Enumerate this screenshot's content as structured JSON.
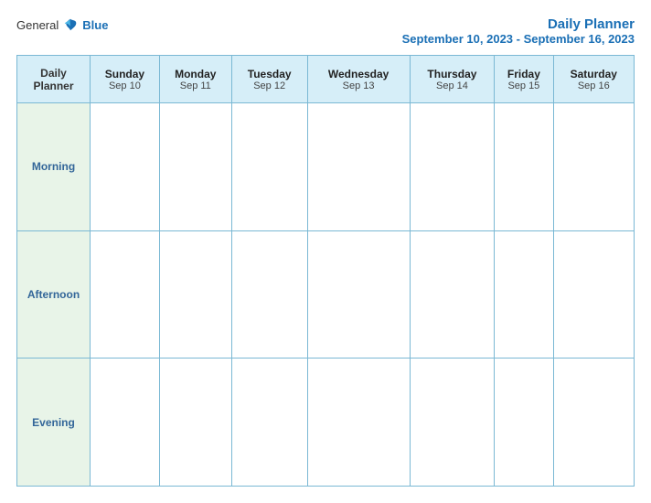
{
  "header": {
    "logo": {
      "general": "General",
      "blue": "Blue"
    },
    "title": "Daily Planner",
    "subtitle": "September 10, 2023 - September 16, 2023"
  },
  "table": {
    "first_col_label_line1": "Daily",
    "first_col_label_line2": "Planner",
    "columns": [
      {
        "day": "Sunday",
        "date": "Sep 10"
      },
      {
        "day": "Monday",
        "date": "Sep 11"
      },
      {
        "day": "Tuesday",
        "date": "Sep 12"
      },
      {
        "day": "Wednesday",
        "date": "Sep 13"
      },
      {
        "day": "Thursday",
        "date": "Sep 14"
      },
      {
        "day": "Friday",
        "date": "Sep 15"
      },
      {
        "day": "Saturday",
        "date": "Sep 16"
      }
    ],
    "rows": [
      {
        "label": "Morning"
      },
      {
        "label": "Afternoon"
      },
      {
        "label": "Evening"
      }
    ]
  }
}
